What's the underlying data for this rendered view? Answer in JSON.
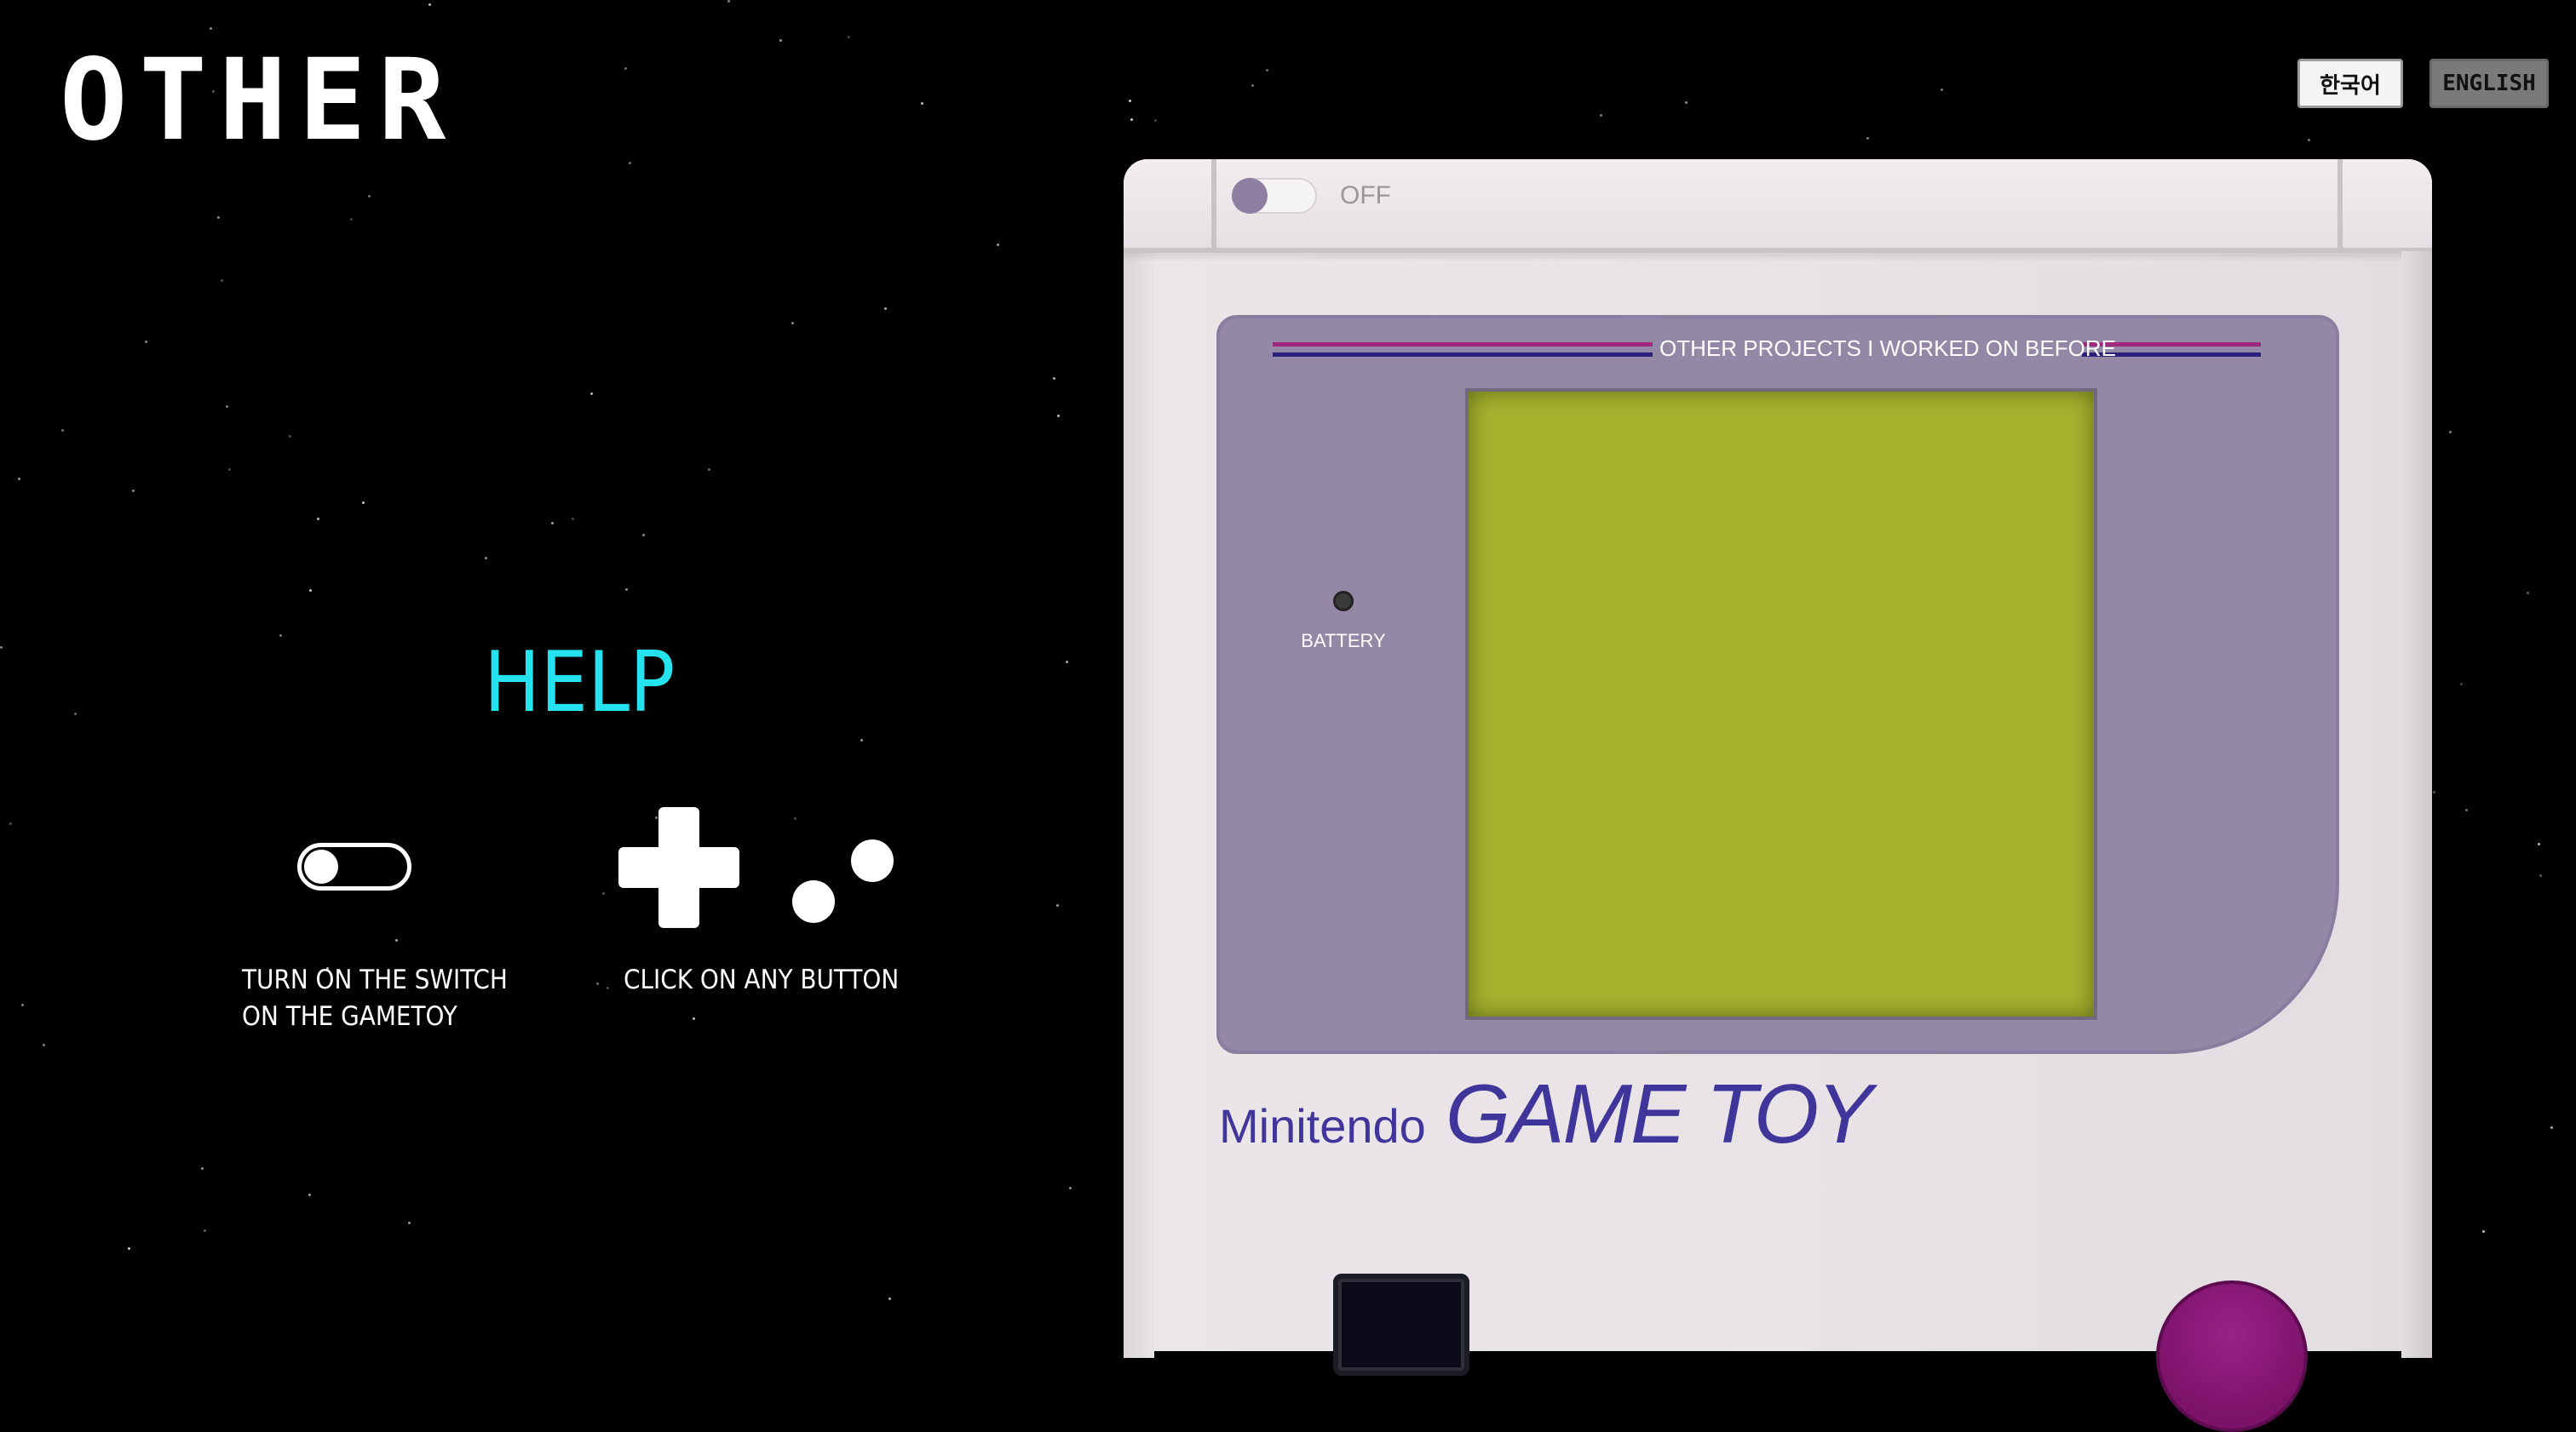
{
  "header": {
    "logo_text": "OTHER",
    "languages": [
      "한국어",
      "ENGLISH"
    ],
    "active_language": "ENGLISH"
  },
  "help": {
    "title": "HELP",
    "step1_line1": "TURN ON THE SWITCH",
    "step1_line2": "ON THE GAMETOY",
    "step2": "CLICK ON ANY BUTTON",
    "icons": [
      "toggle-switch-icon",
      "dpad-icon",
      "ab-buttons-icon"
    ]
  },
  "gametoy": {
    "power_switch_label": "OFF",
    "power_on": false,
    "screen_title": "OTHER PROJECTS I WORKED ON BEFORE",
    "battery_label": "BATTERY",
    "brand_small": "Minitendo",
    "brand_big": "GAME TOY",
    "colors": {
      "body": "#e8e3e6",
      "panel": "#9388a5",
      "screen": "#a6b22e",
      "brand": "#40359a",
      "stripe_magenta": "#a0297f",
      "stripe_navy": "#2a1f7a",
      "a_button": "#8a1a78",
      "help_accent": "#25e3ee"
    }
  }
}
